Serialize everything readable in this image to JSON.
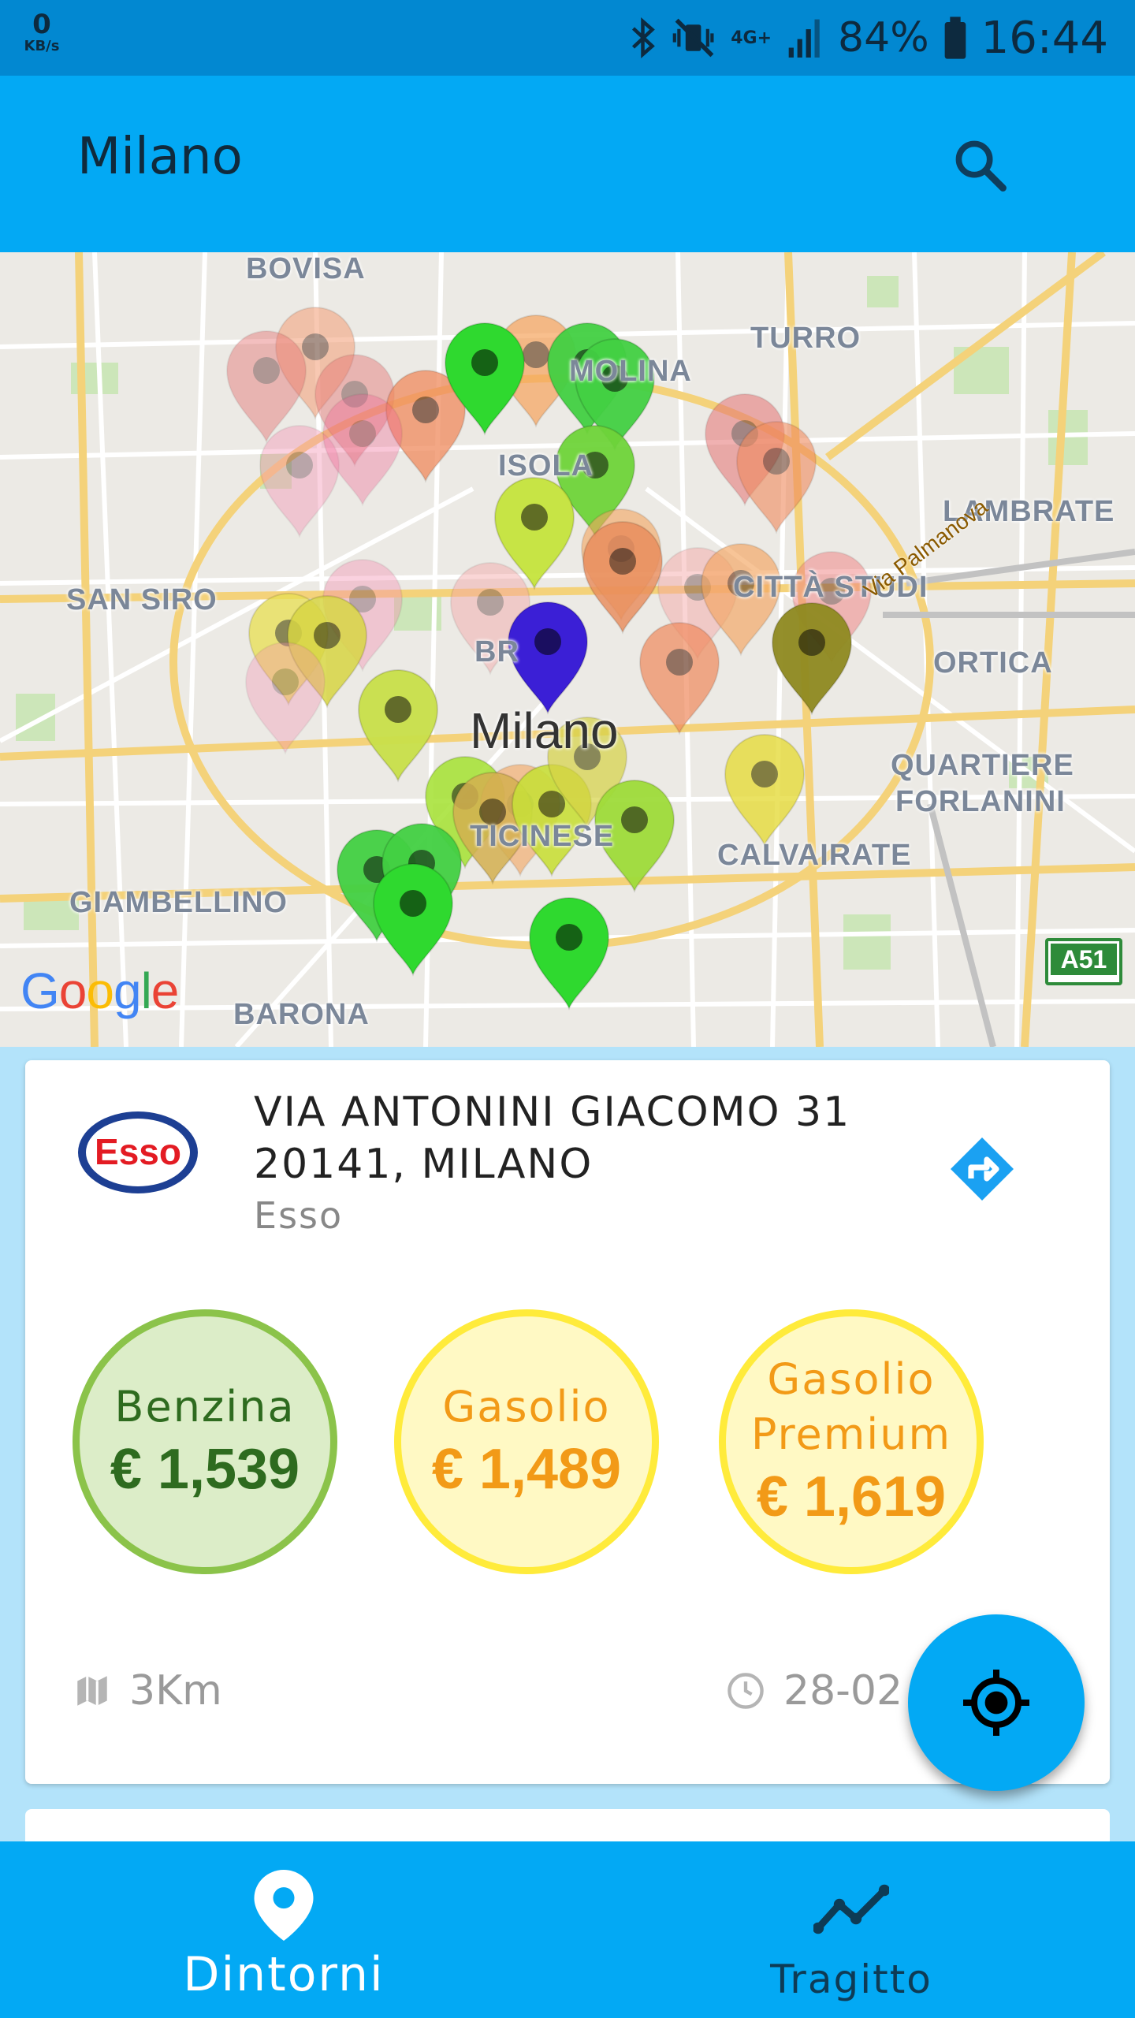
{
  "status_bar": {
    "speed_value": "0",
    "speed_unit": "KB/s",
    "network": "4G+",
    "battery": "84%",
    "time": "16:44"
  },
  "app_bar": {
    "title": "Milano",
    "search_icon": "search-icon"
  },
  "map": {
    "city_label": "Milano",
    "districts": [
      "BOVISA",
      "TURRO",
      "ISOLA",
      "MOLINA",
      "LAMBRATE",
      "SAN SIRO",
      "CITTÀ STUDI",
      "BR",
      "ORTICA",
      "QUARTIERE",
      "FORLANINI",
      "TICINESE",
      "CALVAIRATE",
      "GIAMBELLINO",
      "BARONA"
    ],
    "street_label": "Via Palmanova",
    "highway_badge": "A51",
    "attribution": "Google"
  },
  "station": {
    "brand_logo_text": "Esso",
    "address_line1": "VIA ANTONINI GIACOMO 31",
    "address_line2": "20141, MILANO",
    "brand": "Esso",
    "prices": [
      {
        "fuel": "Benzina",
        "price": "€ 1,539",
        "level": "low"
      },
      {
        "fuel": "Gasolio",
        "price": "€ 1,489",
        "level": "medium"
      },
      {
        "fuel": "Gasolio\nPremium",
        "price": "€ 1,619",
        "level": "medium"
      }
    ],
    "distance": "3Km",
    "date": "28-02"
  },
  "bottom_nav": {
    "items": [
      {
        "label": "Dintorni",
        "icon": "location-pin-icon",
        "active": true
      },
      {
        "label": "Tragitto",
        "icon": "trend-line-icon",
        "active": false
      }
    ]
  },
  "colors": {
    "primary": "#03a9f4",
    "status_bar": "#0288d1",
    "price_low_fill": "#dcedc8",
    "price_low_border": "#8bc34a",
    "price_mid_fill": "#fff9c4",
    "price_mid_border": "#ffeb3b",
    "price_mid_text": "#f29a17",
    "price_low_text": "#2e6b1f",
    "user_marker": "#3b1fd6"
  }
}
